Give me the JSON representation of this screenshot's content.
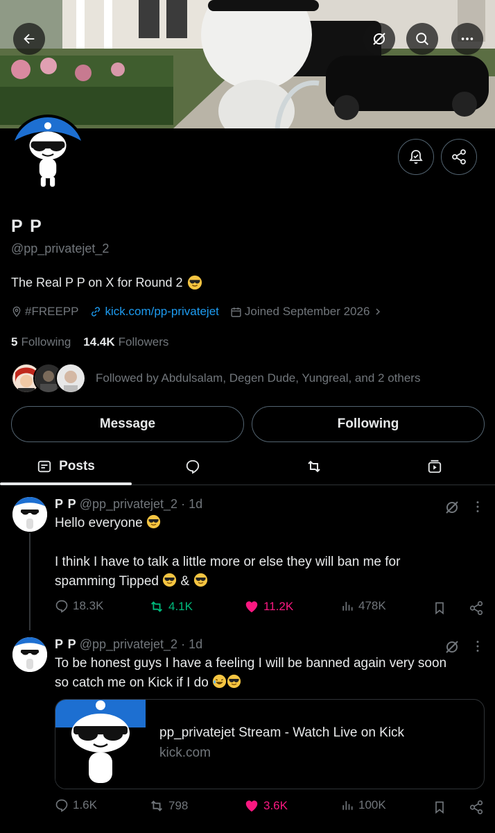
{
  "profile": {
    "name": "P P",
    "handle": "@pp_privatejet_2",
    "bio": "The Real P P on X for Round 2",
    "location": "#FREEPP",
    "link": "kick.com/pp-privatejet",
    "joined": "Joined September 2026",
    "following_count": "5",
    "following_label": "Following",
    "followers_count": "14.4K",
    "followers_label": "Followers",
    "followed_by": "Followed by Abdulsalam, Degen Dude, Yungreal, and 2 others"
  },
  "buttons": {
    "message": "Message",
    "following": "Following"
  },
  "tabs": {
    "posts": "Posts"
  },
  "posts": [
    {
      "name": "P P",
      "handle": "@pp_privatejet_2",
      "time": "· 1d",
      "line1": "Hello everyone",
      "line2": "I think I have to talk a little more or else they will ban me for",
      "line3": "spamming Tipped",
      "line3_mid": "&",
      "replies": "18.3K",
      "reposts": "4.1K",
      "likes": "11.2K",
      "views": "478K"
    },
    {
      "name": "P P",
      "handle": "@pp_privatejet_2",
      "time": "· 1d",
      "line1": "To be honest guys I have a feeling I will be banned again very soon",
      "line2": "so catch me on Kick if I do",
      "card_title": "pp_privatejet Stream - Watch Live on Kick",
      "card_domain": "kick.com",
      "replies": "1.6K",
      "reposts": "798",
      "likes": "3.6K",
      "views": "100K"
    }
  ],
  "colors": {
    "accent": "#1d9bf0",
    "muted": "#71767b",
    "like": "#f91880",
    "repost": "#00ba7c",
    "border": "#2f3336"
  },
  "icons": [
    "back-arrow-icon",
    "grok-icon",
    "search-icon",
    "more-icon",
    "notification-bell-icon",
    "share-icon",
    "location-icon",
    "link-icon",
    "calendar-icon",
    "chevron-right-icon",
    "posts-icon",
    "reply-icon",
    "repost-icon",
    "media-icon",
    "heart-icon",
    "views-icon",
    "bookmark-icon"
  ]
}
